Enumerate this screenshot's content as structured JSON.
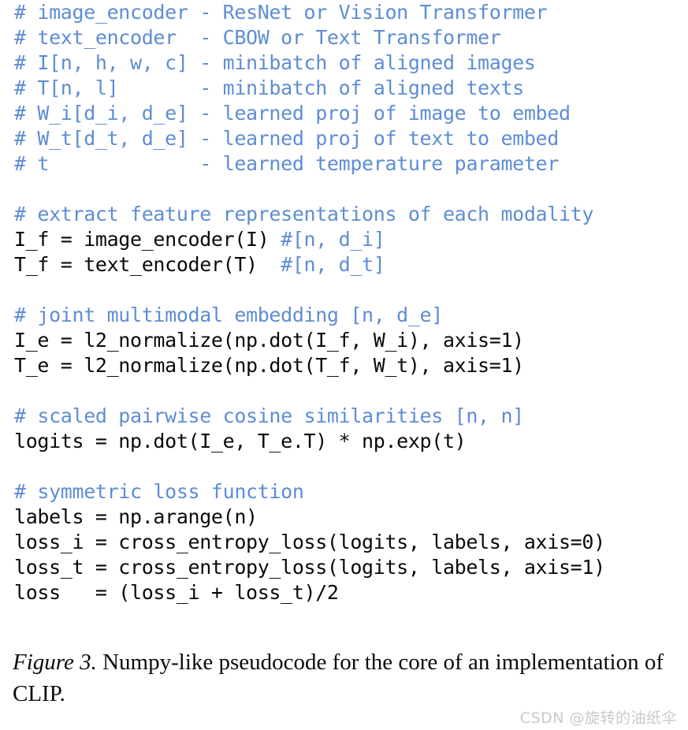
{
  "figure": {
    "background_color": "#ffffff",
    "comment_color": "#5e8dd4",
    "code_color": "#0a0a0a",
    "caption_color": "#0b0b0b",
    "watermark_color": "#c9c9c9"
  },
  "pseudocode": {
    "language": "numpy-like python",
    "lines": [
      {
        "type": "comment",
        "text": "# image_encoder - ResNet or Vision Transformer"
      },
      {
        "type": "comment",
        "text": "# text_encoder  - CBOW or Text Transformer"
      },
      {
        "type": "comment",
        "text": "# I[n, h, w, c] - minibatch of aligned images"
      },
      {
        "type": "comment",
        "text": "# T[n, l]       - minibatch of aligned texts"
      },
      {
        "type": "comment",
        "text": "# W_i[d_i, d_e] - learned proj of image to embed"
      },
      {
        "type": "comment",
        "text": "# W_t[d_t, d_e] - learned proj of text to embed"
      },
      {
        "type": "comment",
        "text": "# t             - learned temperature parameter"
      },
      {
        "type": "blank",
        "text": " "
      },
      {
        "type": "comment",
        "text": "# extract feature representations of each modality"
      },
      {
        "type": "mixed",
        "code": "I_f = image_encoder(I) ",
        "comment": "#[n, d_i]"
      },
      {
        "type": "mixed",
        "code": "T_f = text_encoder(T)  ",
        "comment": "#[n, d_t]"
      },
      {
        "type": "blank",
        "text": " "
      },
      {
        "type": "comment",
        "text": "# joint multimodal embedding [n, d_e]"
      },
      {
        "type": "code",
        "text": "I_e = l2_normalize(np.dot(I_f, W_i), axis=1)"
      },
      {
        "type": "code",
        "text": "T_e = l2_normalize(np.dot(T_f, W_t), axis=1)"
      },
      {
        "type": "blank",
        "text": " "
      },
      {
        "type": "comment",
        "text": "# scaled pairwise cosine similarities [n, n]"
      },
      {
        "type": "code",
        "text": "logits = np.dot(I_e, T_e.T) * np.exp(t)"
      },
      {
        "type": "blank",
        "text": " "
      },
      {
        "type": "comment",
        "text": "# symmetric loss function"
      },
      {
        "type": "code",
        "text": "labels = np.arange(n)"
      },
      {
        "type": "code",
        "text": "loss_i = cross_entropy_loss(logits, labels, axis=0)"
      },
      {
        "type": "code",
        "text": "loss_t = cross_entropy_loss(logits, labels, axis=1)"
      },
      {
        "type": "code",
        "text": "loss   = (loss_i + loss_t)/2"
      }
    ]
  },
  "caption": {
    "label": "Figure 3.",
    "text": " Numpy-like pseudocode for the core of an implementation of CLIP."
  },
  "watermark": {
    "text": "CSDN @旋转的油纸伞"
  }
}
